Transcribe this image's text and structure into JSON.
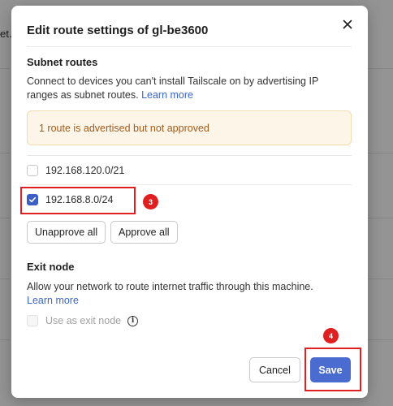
{
  "background": {
    "fragment_text": "et."
  },
  "dialog": {
    "title": "Edit route settings of gl-be3600",
    "close_icon": "close-icon",
    "subnet": {
      "heading": "Subnet routes",
      "description": "Connect to devices you can't install Tailscale on by advertising IP ranges as subnet routes.",
      "learn_more": "Learn more",
      "alert": "1 route is advertised but not approved",
      "routes": [
        {
          "label": "192.168.120.0/21",
          "checked": false
        },
        {
          "label": "192.168.8.0/24",
          "checked": true
        }
      ],
      "unapprove_all_label": "Unapprove all",
      "approve_all_label": "Approve all"
    },
    "exit_node": {
      "heading": "Exit node",
      "description": "Allow your network to route internet traffic through this machine.",
      "learn_more": "Learn more",
      "checkbox_label": "Use as exit node",
      "checkbox_checked": false,
      "checkbox_disabled": true,
      "info_icon": "info-icon"
    },
    "footer": {
      "cancel_label": "Cancel",
      "save_label": "Save"
    }
  },
  "annotations": [
    {
      "number": "3",
      "target": "route 192.168.8.0/24"
    },
    {
      "number": "4",
      "target": "Save button"
    }
  ],
  "colors": {
    "accent": "#4a6bd0",
    "checkbox_checked": "#3c5fc6",
    "link": "#3b66c9",
    "alert_bg": "#fdf6e8",
    "alert_text": "#a55a1a",
    "annotation": "#e02020"
  }
}
